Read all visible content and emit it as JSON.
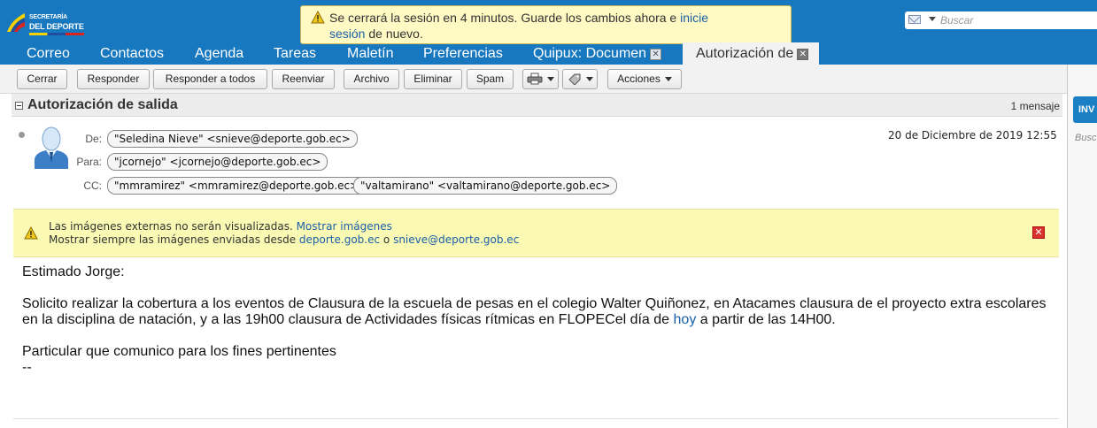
{
  "brand": {
    "line1": "SECRETARÍA",
    "line2": "DEL DEPORTE"
  },
  "session_alert": {
    "before": "Se cerrará la sesión en 4 minutos. Guarde los cambios ahora e ",
    "link1": "inicie",
    "link2": "sesión",
    "after": " de nuevo."
  },
  "search": {
    "placeholder": "Buscar"
  },
  "tabs": [
    {
      "label": "Correo"
    },
    {
      "label": "Contactos"
    },
    {
      "label": "Agenda"
    },
    {
      "label": "Tareas"
    },
    {
      "label": "Maletín"
    },
    {
      "label": "Preferencias"
    },
    {
      "label": "Quipux: Documen"
    },
    {
      "label": "Autorización de"
    }
  ],
  "toolbar": {
    "close": "Cerrar",
    "reply": "Responder",
    "reply_all": "Responder a todos",
    "forward": "Reenviar",
    "archive": "Archivo",
    "delete": "Eliminar",
    "spam": "Spam",
    "actions": "Acciones"
  },
  "right_panel": {
    "button": "INV",
    "search_hint": "Busc"
  },
  "message": {
    "subject": "Autorización de salida",
    "count": "1 mensaje",
    "from_label": "De:",
    "to_label": "Para:",
    "cc_label": "CC:",
    "from": "\"Seledina Nieve\" <snieve@deporte.gob.ec>",
    "to": "\"jcornejo\" <jcornejo@deporte.gob.ec>",
    "cc": [
      "\"mmramirez\" <mmramirez@deporte.gob.ec>",
      "\"valtamirano\" <valtamirano@deporte.gob.ec>"
    ],
    "date": "20 de Diciembre de 2019 12:55"
  },
  "image_warning": {
    "line1": "Las imágenes externas no serán visualizadas. ",
    "show_images": "Mostrar imágenes",
    "line2": "Mostrar siempre las imágenes enviadas desde ",
    "domain": "deporte.gob.ec",
    "or": " o ",
    "sender": "snieve@deporte.gob.ec"
  },
  "body": {
    "greeting": "Estimado Jorge:",
    "para1a": "Solicito realizar la cobertura a los eventos de Clausura de la escuela de pesas en el colegio Walter Quiñonez, en Atacames clausura de el proyecto extra escolares",
    "para1b": "en la disciplina de natación, y a las 19h00 clausura de Actividades físicas rítmicas en FLOPECel día de ",
    "today_link": "hoy",
    "para1c": " a partir de las 14H00.",
    "closing": "Particular que comunico para los fines pertinentes",
    "signature": "--"
  },
  "colors": {
    "header_blue": "#1778bf",
    "alert_yellow": "#fff9c4",
    "link_blue": "#1a5fa8",
    "warning_yellow": "#fafab4"
  }
}
